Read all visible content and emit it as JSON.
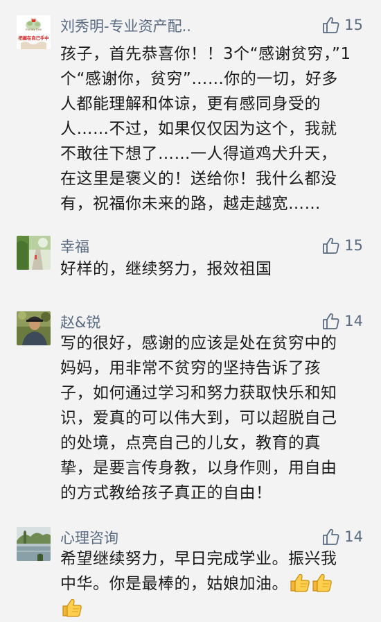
{
  "comments": [
    {
      "name": "刘秀明-专业资产配..",
      "likes": "15",
      "avatar_text_top": "银脉",
      "avatar_text_mid": "money tree",
      "avatar_text_bottom": "把握在自己手中",
      "text": "孩子，首先恭喜你！！3个“感谢贫穷，”1个“感谢你，贫穷”……你的一切，好多人都能理解和体谅，更有感同身受的人……不过，如果仅仅因为这个，我就不敢往下想了……一人得道鸡犬升天，在这里是褒义的！送给你！我什么都没有，祝福你未来的路，越走越宽……"
    },
    {
      "name": "幸福",
      "likes": "15",
      "text": "好样的，继续努力，报效祖国"
    },
    {
      "name": "赵&锐",
      "likes": "14",
      "text": "写的很好，感谢的应该是处在贫穷中的妈妈，用非常不贫穷的坚持告诉了孩子，如何通过学习和努力获取快乐和知识，爱真的可以伟大到，可以超脱自己的处境，点亮自己的儿女，教育的真挚，是要言传身教，以身作则，用自由的方式教给孩子真正的自由！"
    },
    {
      "name": "心理咨询",
      "likes": "14",
      "text": "希望继续努力，早日完成学业。振兴我中华。你是最棒的，姑娘加油。",
      "emojis": [
        "thumbs-up-emoji",
        "thumbs-up-emoji",
        "thumbs-up-emoji"
      ]
    }
  ],
  "colors": {
    "background": "#f3f3f3",
    "name": "#5a6b82",
    "text": "#1b1b1b",
    "like": "#5a6b82"
  }
}
